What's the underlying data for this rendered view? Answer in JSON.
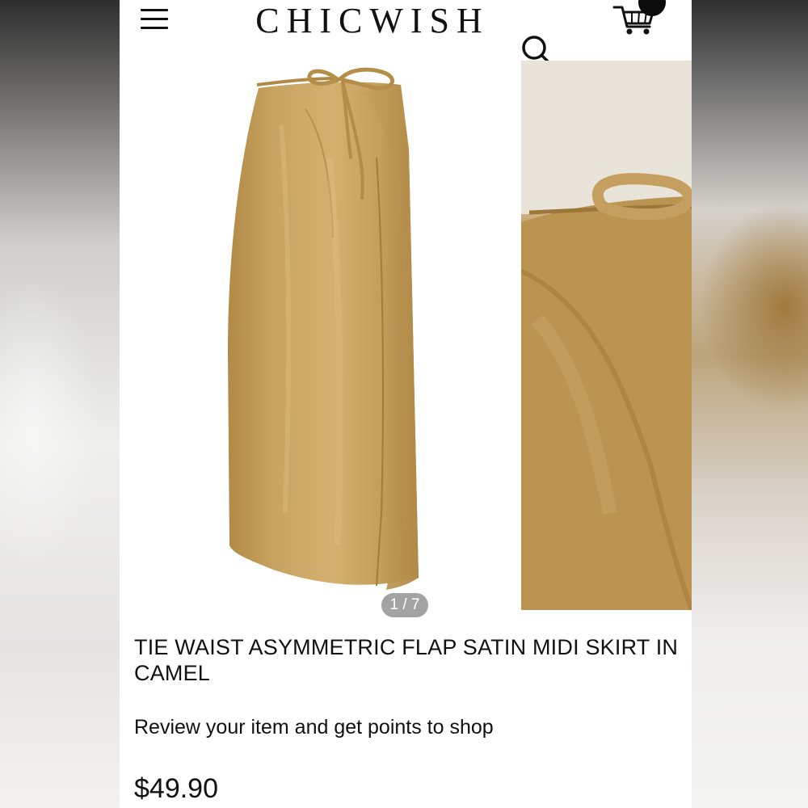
{
  "header": {
    "brand": "CHICWISH",
    "icons": {
      "menu": "hamburger-menu-icon",
      "cart": "shopping-cart-icon",
      "search": "search-icon"
    }
  },
  "gallery": {
    "counter": "1 / 7",
    "main_image": "camel satin wrap midi skirt with tie waist, front view",
    "side_image": "close-up of tie waist and draped satin fabric"
  },
  "product": {
    "title": "TIE WAIST ASYMMETRIC FLAP SATIN MIDI SKIRT IN CAMEL",
    "review_prompt": "Review your item and get points to shop",
    "price": "$49.90"
  },
  "colors": {
    "camel": "#c19d5c",
    "badge_gray": "#a3a3a3",
    "text": "#111111"
  }
}
